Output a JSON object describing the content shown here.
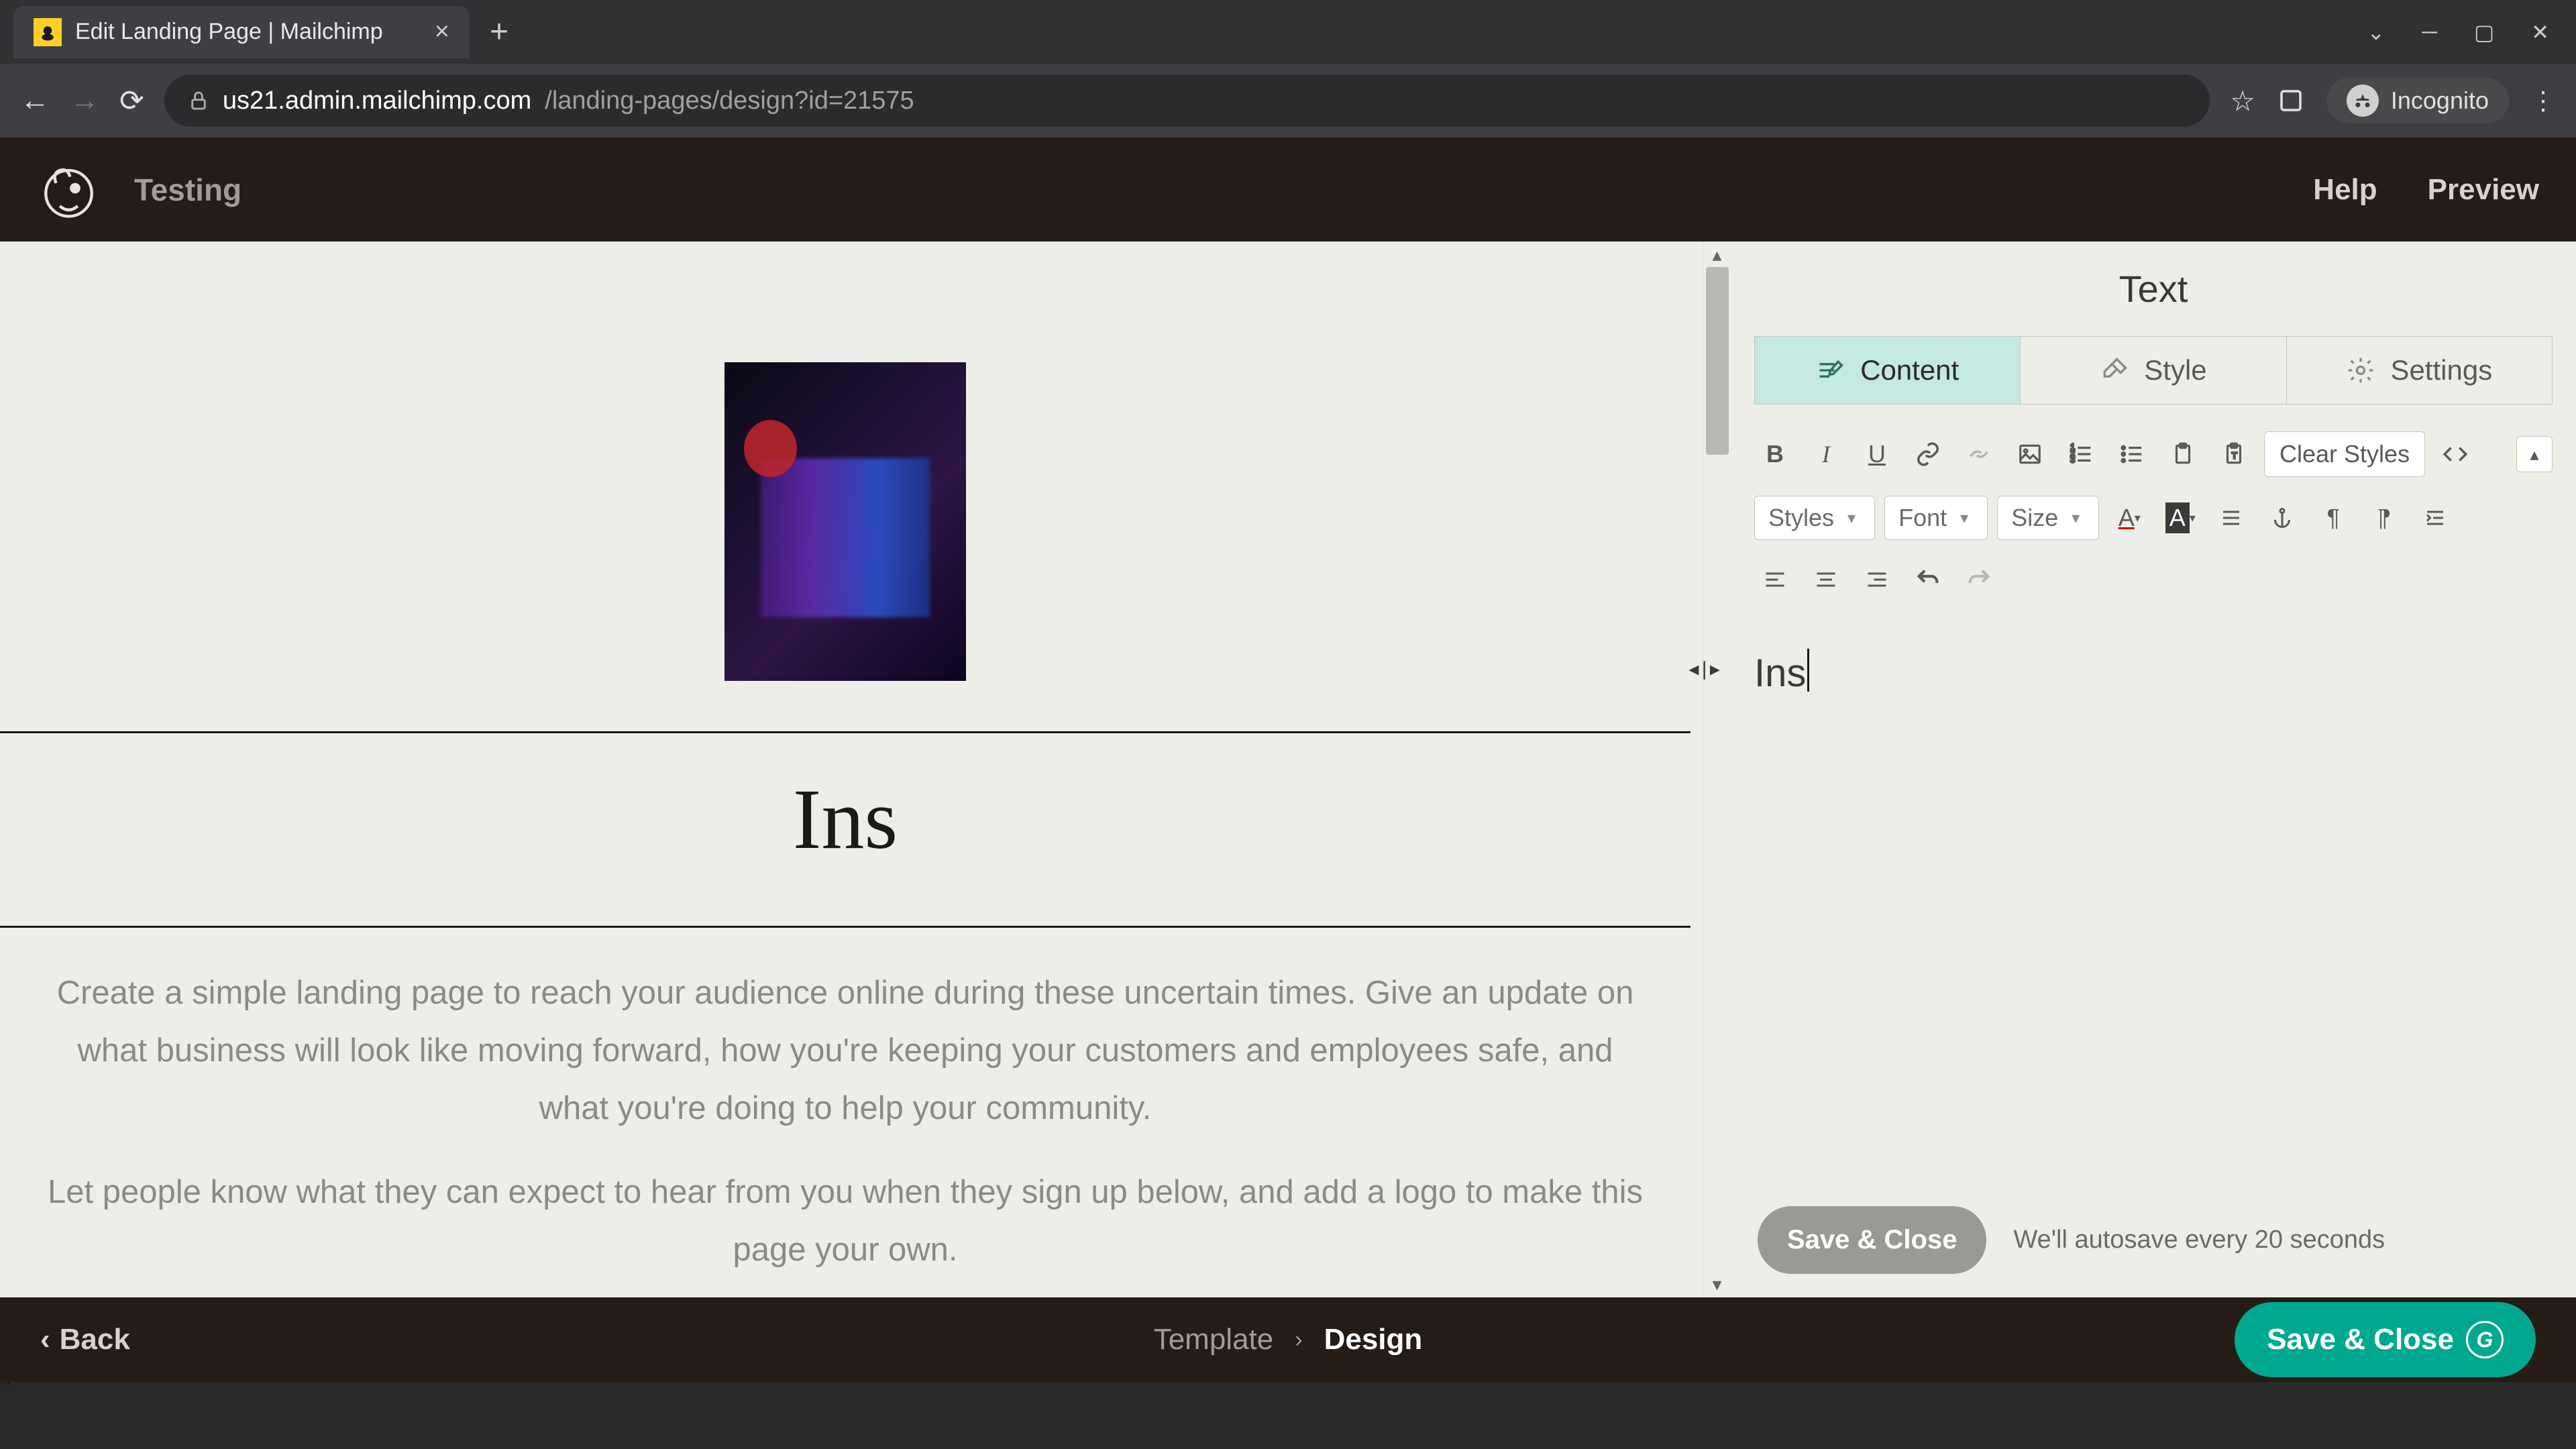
{
  "browser": {
    "tab_title": "Edit Landing Page | Mailchimp",
    "url_host": "us21.admin.mailchimp.com",
    "url_path": "/landing-pages/design?id=21575",
    "incognito_label": "Incognito"
  },
  "header": {
    "page_name": "Testing",
    "help": "Help",
    "preview": "Preview"
  },
  "canvas": {
    "heading": "Ins",
    "paragraph1": "Create a simple landing page to reach your audience online during these uncertain times. Give an update on what business will look like moving forward, how you're keeping your customers and employees safe, and what you're doing to help your community.",
    "paragraph2": "Let people know what they can expect to hear from you when they sign up below, and add a logo to make this page your own."
  },
  "panel": {
    "title": "Text",
    "tabs": {
      "content": "Content",
      "style": "Style",
      "settings": "Settings"
    },
    "selects": {
      "styles": "Styles",
      "font": "Font",
      "size": "Size"
    },
    "clear_styles": "Clear Styles",
    "editor_value": "Ins",
    "save_close": "Save & Close",
    "autosave": "We'll autosave every 20 seconds"
  },
  "footer": {
    "back": "Back",
    "crumb_template": "Template",
    "crumb_design": "Design",
    "save_close": "Save & Close"
  }
}
